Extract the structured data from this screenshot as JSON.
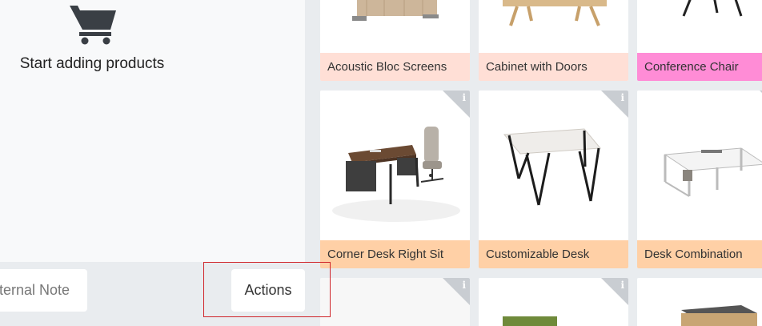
{
  "order": {
    "empty_message": "Start adding products",
    "internal_note_label": "Internal Note",
    "actions_label": "Actions"
  },
  "products": [
    {
      "name": "Acoustic Bloc Screens",
      "label_color": "#ffdfd6"
    },
    {
      "name": "Cabinet with Doors",
      "label_color": "#ffdfd6"
    },
    {
      "name": "Conference Chair",
      "label_color": "#ff8cd6"
    },
    {
      "name": "Corner Desk Right Sit",
      "label_color": "#ffd0a6"
    },
    {
      "name": "Customizable Desk",
      "label_color": "#ffd0a6"
    },
    {
      "name": "Desk Combination",
      "label_color": "#ffd0a6"
    }
  ],
  "icons": {
    "cart": "shopping-cart-icon",
    "info": "info-icon"
  },
  "info_glyph": "i"
}
